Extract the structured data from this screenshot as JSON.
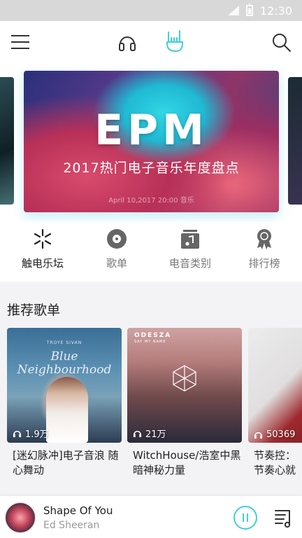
{
  "status_bar": {
    "time": "12:30"
  },
  "top_nav": {
    "icons": [
      "menu-icon",
      "headphones-icon",
      "rock-hand-icon",
      "search-icon"
    ],
    "active_color": "#3fd0d8"
  },
  "banner": {
    "title": "EPM",
    "subtitle": "2017热门电子音乐年度盘点",
    "date": "April 10,2017 20:00 音乐"
  },
  "categories": [
    {
      "label": "触电乐坛",
      "icon": "spark-icon"
    },
    {
      "label": "歌单",
      "icon": "disc-icon"
    },
    {
      "label": "电音类别",
      "icon": "music-folder-icon"
    },
    {
      "label": "排行榜",
      "icon": "award-icon"
    }
  ],
  "section": {
    "title": "推荐歌单"
  },
  "playlists": [
    {
      "count": "1.9万",
      "name": "[迷幻脉冲]电子音浪 随心舞动",
      "cover_text": "Blue Neighbourhood",
      "cover_small": "TROYE SIVAN"
    },
    {
      "count": "21万",
      "name": "WitchHouse/浩室中黑暗神秘力量",
      "cover_text": "ODESZA",
      "cover_small": "SAY MY NAME"
    },
    {
      "count": "50369",
      "name": "节奏控：节奏心就起飞了"
    }
  ],
  "now_playing": {
    "song": "Shape Of You",
    "artist": "Ed Sheeran",
    "accent": "#3fd0d8"
  }
}
